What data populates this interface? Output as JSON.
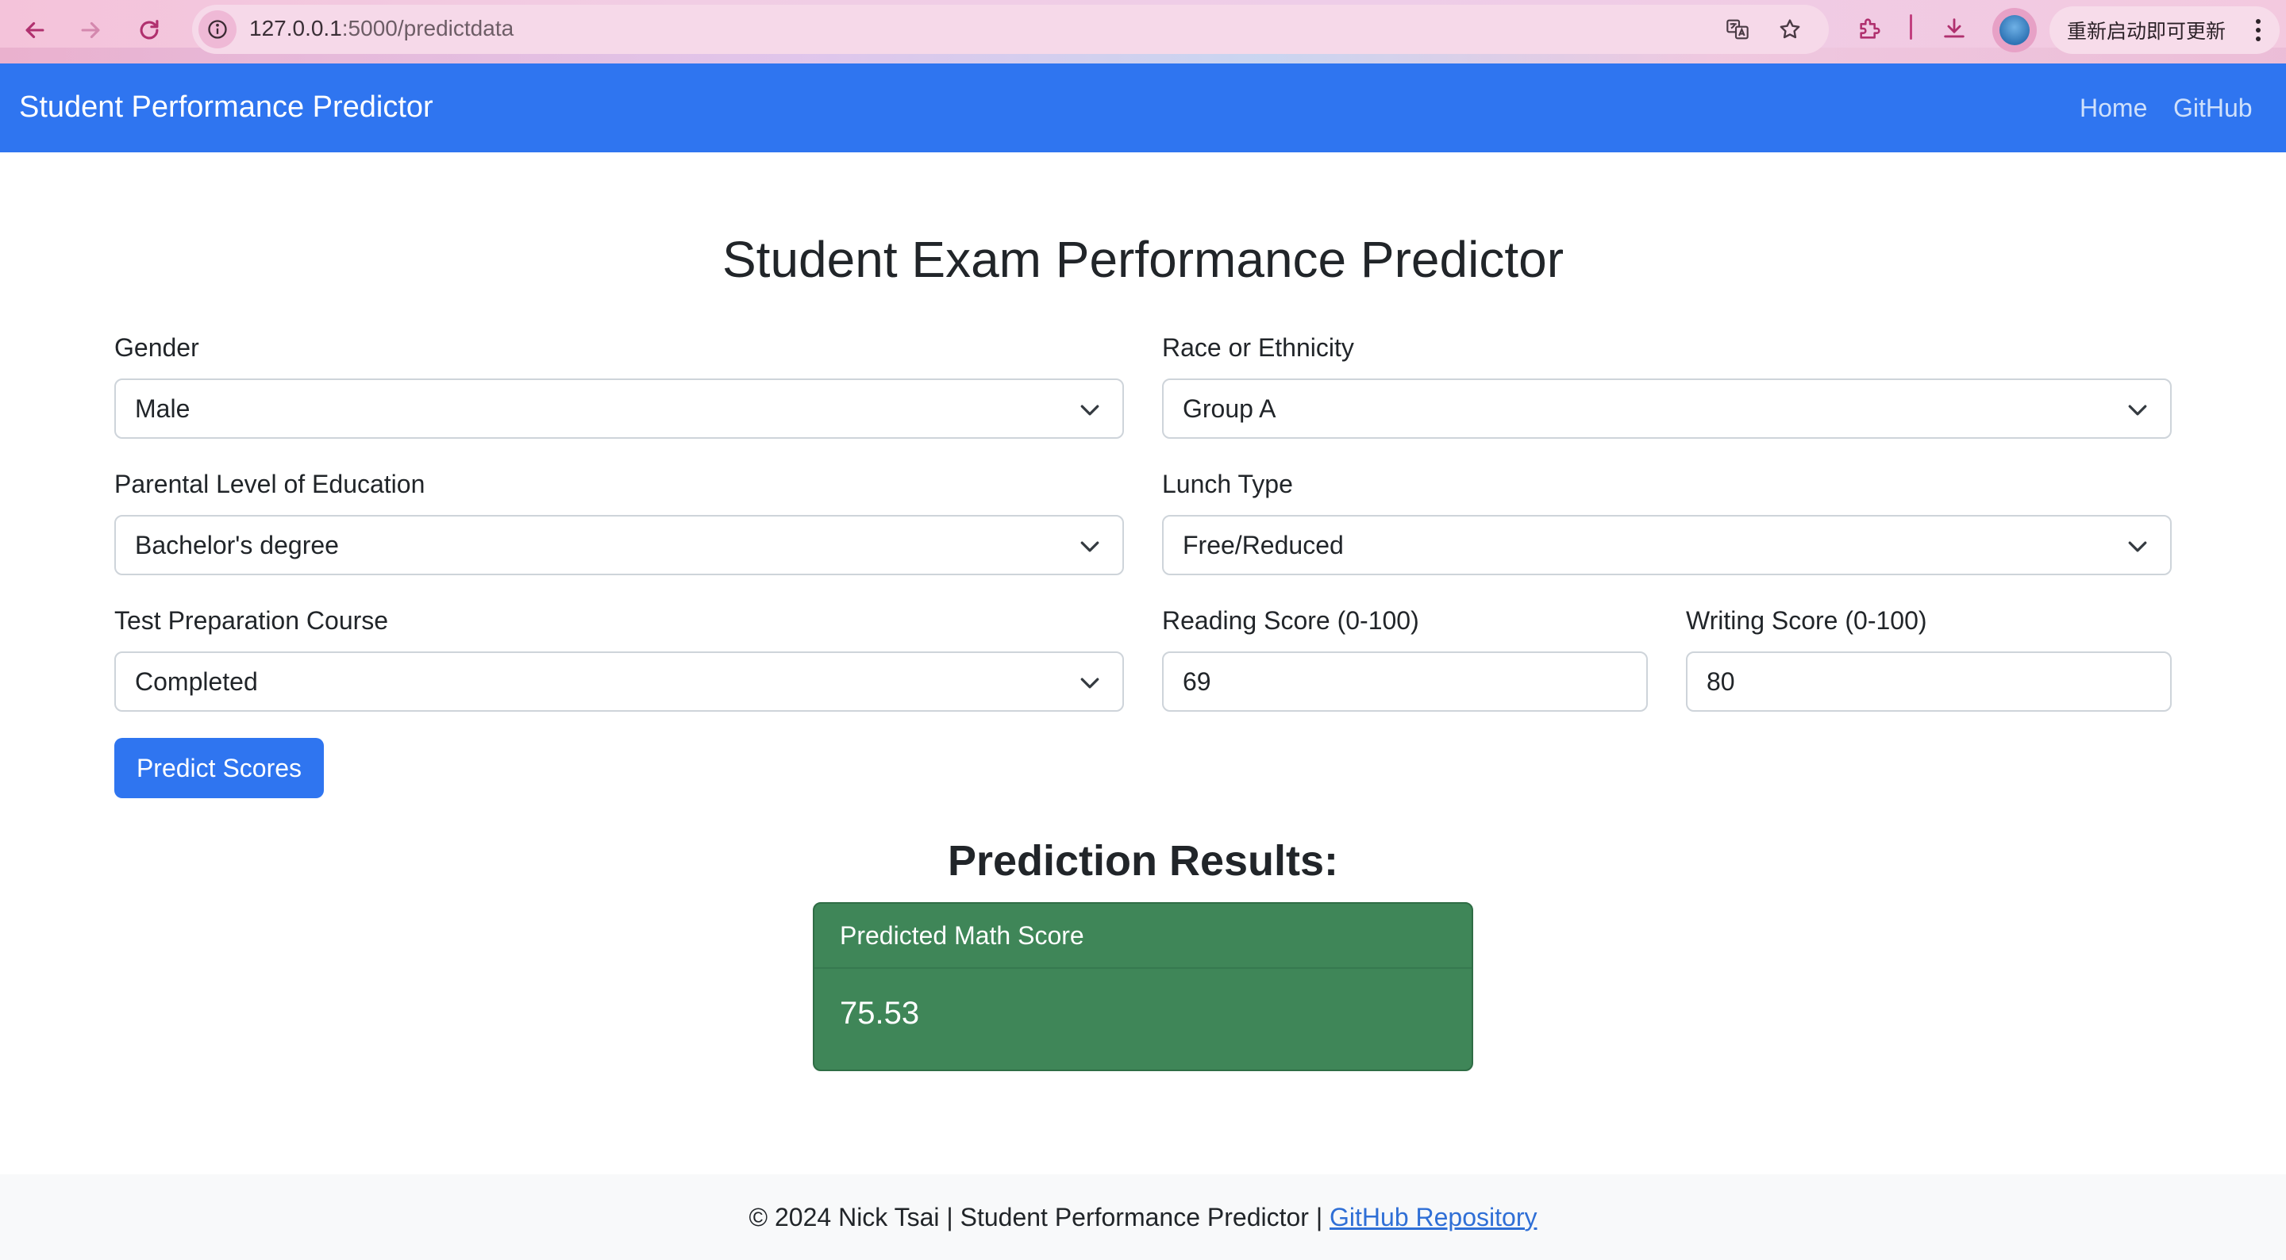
{
  "browser": {
    "url_host": "127.0.0.1",
    "url_path": ":5000/predictdata",
    "update_label": "重新启动即可更新",
    "icons": [
      "back-arrow-icon",
      "forward-arrow-icon",
      "reload-icon",
      "site-info-icon",
      "translate-icon",
      "bookmark-star-icon",
      "extensions-icon",
      "download-icon",
      "profile-avatar-icon",
      "more-options-icon"
    ]
  },
  "navbar": {
    "brand": "Student Performance Predictor",
    "links": [
      "Home",
      "GitHub"
    ]
  },
  "main": {
    "title": "Student Exam Performance Predictor",
    "fields": {
      "gender": {
        "label": "Gender",
        "value": "Male"
      },
      "race": {
        "label": "Race or Ethnicity",
        "value": "Group A"
      },
      "parental_education": {
        "label": "Parental Level of Education",
        "value": "Bachelor's degree"
      },
      "lunch": {
        "label": "Lunch Type",
        "value": "Free/Reduced"
      },
      "test_prep": {
        "label": "Test Preparation Course",
        "value": "Completed"
      },
      "reading": {
        "label": "Reading Score (0-100)",
        "value": "69"
      },
      "writing": {
        "label": "Writing Score (0-100)",
        "value": "80"
      }
    },
    "submit_label": "Predict Scores",
    "results_title": "Prediction Results:",
    "result": {
      "header": "Predicted Math Score",
      "value": "75.53"
    }
  },
  "footer": {
    "text": "© 2024 Nick Tsai | Student Performance Predictor | ",
    "link": "GitHub Repository"
  },
  "colors": {
    "primary": "#2f75f0",
    "success": "#3f8658",
    "chrome": "#f4c3da"
  }
}
